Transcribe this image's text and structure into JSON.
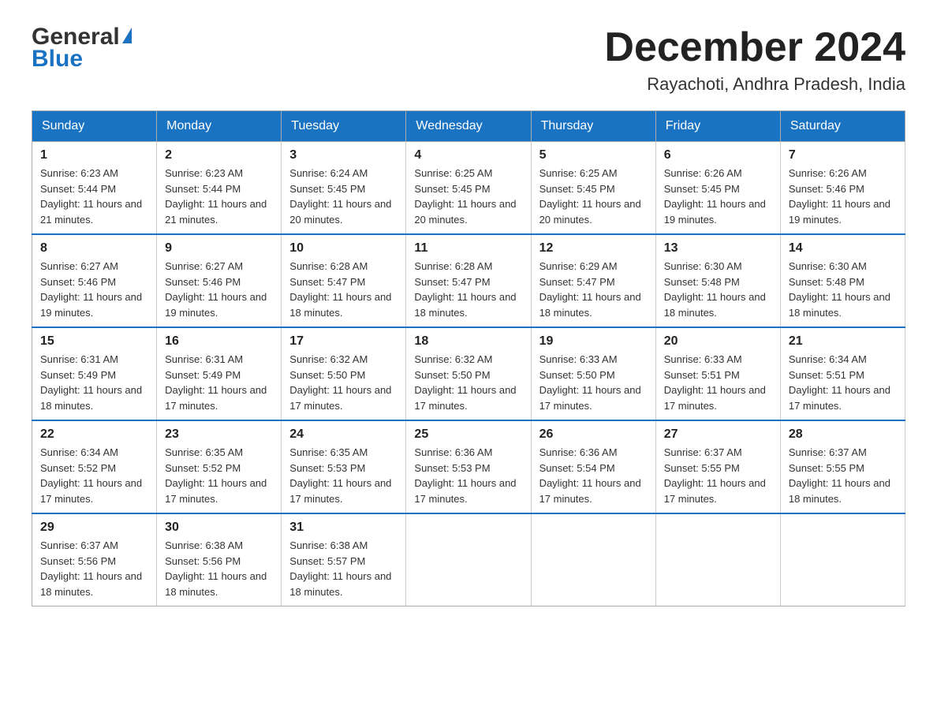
{
  "header": {
    "logo_general": "General",
    "logo_blue": "Blue",
    "month_title": "December 2024",
    "location": "Rayachoti, Andhra Pradesh, India"
  },
  "days_of_week": [
    "Sunday",
    "Monday",
    "Tuesday",
    "Wednesday",
    "Thursday",
    "Friday",
    "Saturday"
  ],
  "weeks": [
    [
      {
        "day": "1",
        "sunrise": "6:23 AM",
        "sunset": "5:44 PM",
        "daylight": "11 hours and 21 minutes."
      },
      {
        "day": "2",
        "sunrise": "6:23 AM",
        "sunset": "5:44 PM",
        "daylight": "11 hours and 21 minutes."
      },
      {
        "day": "3",
        "sunrise": "6:24 AM",
        "sunset": "5:45 PM",
        "daylight": "11 hours and 20 minutes."
      },
      {
        "day": "4",
        "sunrise": "6:25 AM",
        "sunset": "5:45 PM",
        "daylight": "11 hours and 20 minutes."
      },
      {
        "day": "5",
        "sunrise": "6:25 AM",
        "sunset": "5:45 PM",
        "daylight": "11 hours and 20 minutes."
      },
      {
        "day": "6",
        "sunrise": "6:26 AM",
        "sunset": "5:45 PM",
        "daylight": "11 hours and 19 minutes."
      },
      {
        "day": "7",
        "sunrise": "6:26 AM",
        "sunset": "5:46 PM",
        "daylight": "11 hours and 19 minutes."
      }
    ],
    [
      {
        "day": "8",
        "sunrise": "6:27 AM",
        "sunset": "5:46 PM",
        "daylight": "11 hours and 19 minutes."
      },
      {
        "day": "9",
        "sunrise": "6:27 AM",
        "sunset": "5:46 PM",
        "daylight": "11 hours and 19 minutes."
      },
      {
        "day": "10",
        "sunrise": "6:28 AM",
        "sunset": "5:47 PM",
        "daylight": "11 hours and 18 minutes."
      },
      {
        "day": "11",
        "sunrise": "6:28 AM",
        "sunset": "5:47 PM",
        "daylight": "11 hours and 18 minutes."
      },
      {
        "day": "12",
        "sunrise": "6:29 AM",
        "sunset": "5:47 PM",
        "daylight": "11 hours and 18 minutes."
      },
      {
        "day": "13",
        "sunrise": "6:30 AM",
        "sunset": "5:48 PM",
        "daylight": "11 hours and 18 minutes."
      },
      {
        "day": "14",
        "sunrise": "6:30 AM",
        "sunset": "5:48 PM",
        "daylight": "11 hours and 18 minutes."
      }
    ],
    [
      {
        "day": "15",
        "sunrise": "6:31 AM",
        "sunset": "5:49 PM",
        "daylight": "11 hours and 18 minutes."
      },
      {
        "day": "16",
        "sunrise": "6:31 AM",
        "sunset": "5:49 PM",
        "daylight": "11 hours and 17 minutes."
      },
      {
        "day": "17",
        "sunrise": "6:32 AM",
        "sunset": "5:50 PM",
        "daylight": "11 hours and 17 minutes."
      },
      {
        "day": "18",
        "sunrise": "6:32 AM",
        "sunset": "5:50 PM",
        "daylight": "11 hours and 17 minutes."
      },
      {
        "day": "19",
        "sunrise": "6:33 AM",
        "sunset": "5:50 PM",
        "daylight": "11 hours and 17 minutes."
      },
      {
        "day": "20",
        "sunrise": "6:33 AM",
        "sunset": "5:51 PM",
        "daylight": "11 hours and 17 minutes."
      },
      {
        "day": "21",
        "sunrise": "6:34 AM",
        "sunset": "5:51 PM",
        "daylight": "11 hours and 17 minutes."
      }
    ],
    [
      {
        "day": "22",
        "sunrise": "6:34 AM",
        "sunset": "5:52 PM",
        "daylight": "11 hours and 17 minutes."
      },
      {
        "day": "23",
        "sunrise": "6:35 AM",
        "sunset": "5:52 PM",
        "daylight": "11 hours and 17 minutes."
      },
      {
        "day": "24",
        "sunrise": "6:35 AM",
        "sunset": "5:53 PM",
        "daylight": "11 hours and 17 minutes."
      },
      {
        "day": "25",
        "sunrise": "6:36 AM",
        "sunset": "5:53 PM",
        "daylight": "11 hours and 17 minutes."
      },
      {
        "day": "26",
        "sunrise": "6:36 AM",
        "sunset": "5:54 PM",
        "daylight": "11 hours and 17 minutes."
      },
      {
        "day": "27",
        "sunrise": "6:37 AM",
        "sunset": "5:55 PM",
        "daylight": "11 hours and 17 minutes."
      },
      {
        "day": "28",
        "sunrise": "6:37 AM",
        "sunset": "5:55 PM",
        "daylight": "11 hours and 18 minutes."
      }
    ],
    [
      {
        "day": "29",
        "sunrise": "6:37 AM",
        "sunset": "5:56 PM",
        "daylight": "11 hours and 18 minutes."
      },
      {
        "day": "30",
        "sunrise": "6:38 AM",
        "sunset": "5:56 PM",
        "daylight": "11 hours and 18 minutes."
      },
      {
        "day": "31",
        "sunrise": "6:38 AM",
        "sunset": "5:57 PM",
        "daylight": "11 hours and 18 minutes."
      },
      null,
      null,
      null,
      null
    ]
  ]
}
